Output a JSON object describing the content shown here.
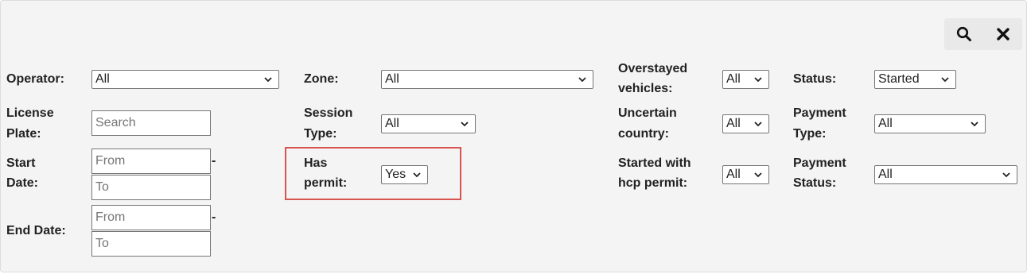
{
  "toolbar": {
    "search_icon": "search-icon",
    "close_icon": "close-icon"
  },
  "filters": {
    "operator": {
      "label": "Operator:",
      "value": "All"
    },
    "license_plate": {
      "label_line1": "License",
      "label_line2": "Plate:",
      "placeholder": "Search"
    },
    "start_date": {
      "label_line1": "Start",
      "label_line2": "Date:",
      "from_placeholder": "From",
      "to_placeholder": "To",
      "separator": "-"
    },
    "end_date": {
      "label": "End Date:",
      "from_placeholder": "From",
      "to_placeholder": "To",
      "separator": "-"
    },
    "zone": {
      "label": "Zone:",
      "value": "All"
    },
    "session_type": {
      "label_line1": "Session",
      "label_line2": "Type:",
      "value": "All"
    },
    "has_permit": {
      "label_line1": "Has",
      "label_line2": "permit:",
      "value": "Yes"
    },
    "overstayed_vehicles": {
      "label_line1": "Overstayed",
      "label_line2": "vehicles:",
      "value": "All"
    },
    "uncertain_country": {
      "label_line1": "Uncertain",
      "label_line2": "country:",
      "value": "All"
    },
    "started_with_hcp_permit": {
      "label_line1": "Started with",
      "label_line2": "hcp permit:",
      "value": "All"
    },
    "status": {
      "label": "Status:",
      "value": "Started"
    },
    "payment_type": {
      "label_line1": "Payment",
      "label_line2": "Type:",
      "value": "All"
    },
    "payment_status": {
      "label_line1": "Payment",
      "label_line2": "Status:",
      "value": "All"
    }
  },
  "colors": {
    "highlight_border": "#d9534f",
    "panel_background": "#f4f4f4"
  }
}
